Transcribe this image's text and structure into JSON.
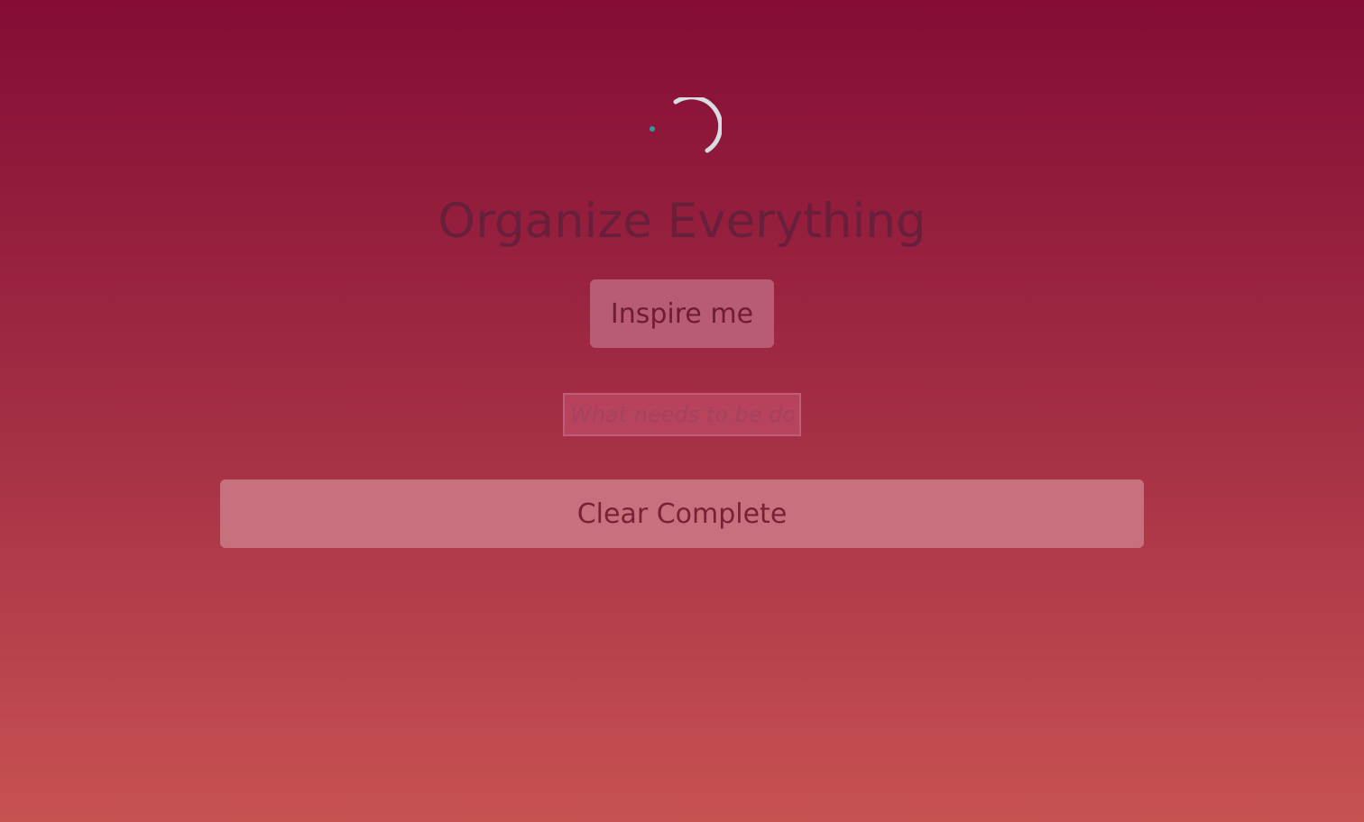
{
  "app": {
    "title": "Organize Everything"
  },
  "actions": {
    "inspire_label": "Inspire me",
    "clear_label": "Clear Complete"
  },
  "new_todo": {
    "value": "",
    "placeholder": "What needs to be done"
  },
  "loading": {
    "icon": "loading-spinner-icon",
    "arc_color": "#d8dce3",
    "dot_color": "#2d9c9c"
  },
  "colors": {
    "background_top": "#850c35",
    "background_bottom": "#c75252",
    "title": "#681f3b",
    "inspire_button": "#b85b74",
    "clear_button": "#c6717d"
  }
}
